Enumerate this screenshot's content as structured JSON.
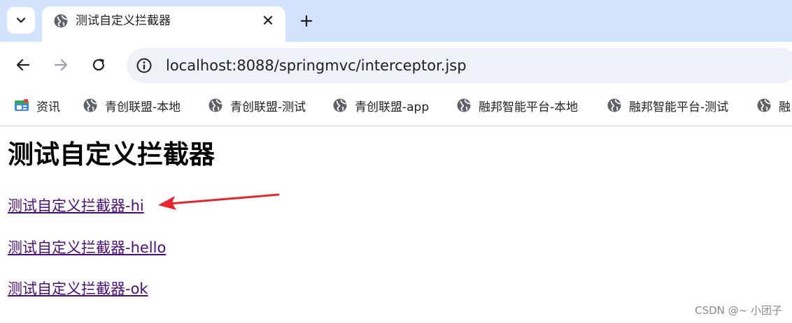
{
  "tab": {
    "title": "测试自定义拦截器",
    "favicon": "globe-icon"
  },
  "toolbar": {
    "url": "localhost:8088/springmvc/interceptor.jsp"
  },
  "bookmarks": [
    {
      "label": "资讯",
      "icon": "news-icon"
    },
    {
      "label": "青创联盟-本地",
      "icon": "globe-icon"
    },
    {
      "label": "青创联盟-测试",
      "icon": "globe-icon"
    },
    {
      "label": "青创联盟-app",
      "icon": "globe-icon"
    },
    {
      "label": "融邦智能平台-本地",
      "icon": "globe-icon"
    },
    {
      "label": "融邦智能平台-测试",
      "icon": "globe-icon"
    },
    {
      "label": "融",
      "icon": "globe-icon"
    }
  ],
  "page": {
    "heading": "测试自定义拦截器",
    "links": [
      {
        "label": "测试自定义拦截器-hi"
      },
      {
        "label": "测试自定义拦截器-hello"
      },
      {
        "label": "测试自定义拦截器-ok"
      }
    ]
  },
  "watermark": "CSDN @~ 小团子",
  "colors": {
    "tabstrip": "#d3e3fd",
    "omnibox": "#eef1f7",
    "visited_link": "#4a0f77",
    "arrow": "#e8252a"
  }
}
